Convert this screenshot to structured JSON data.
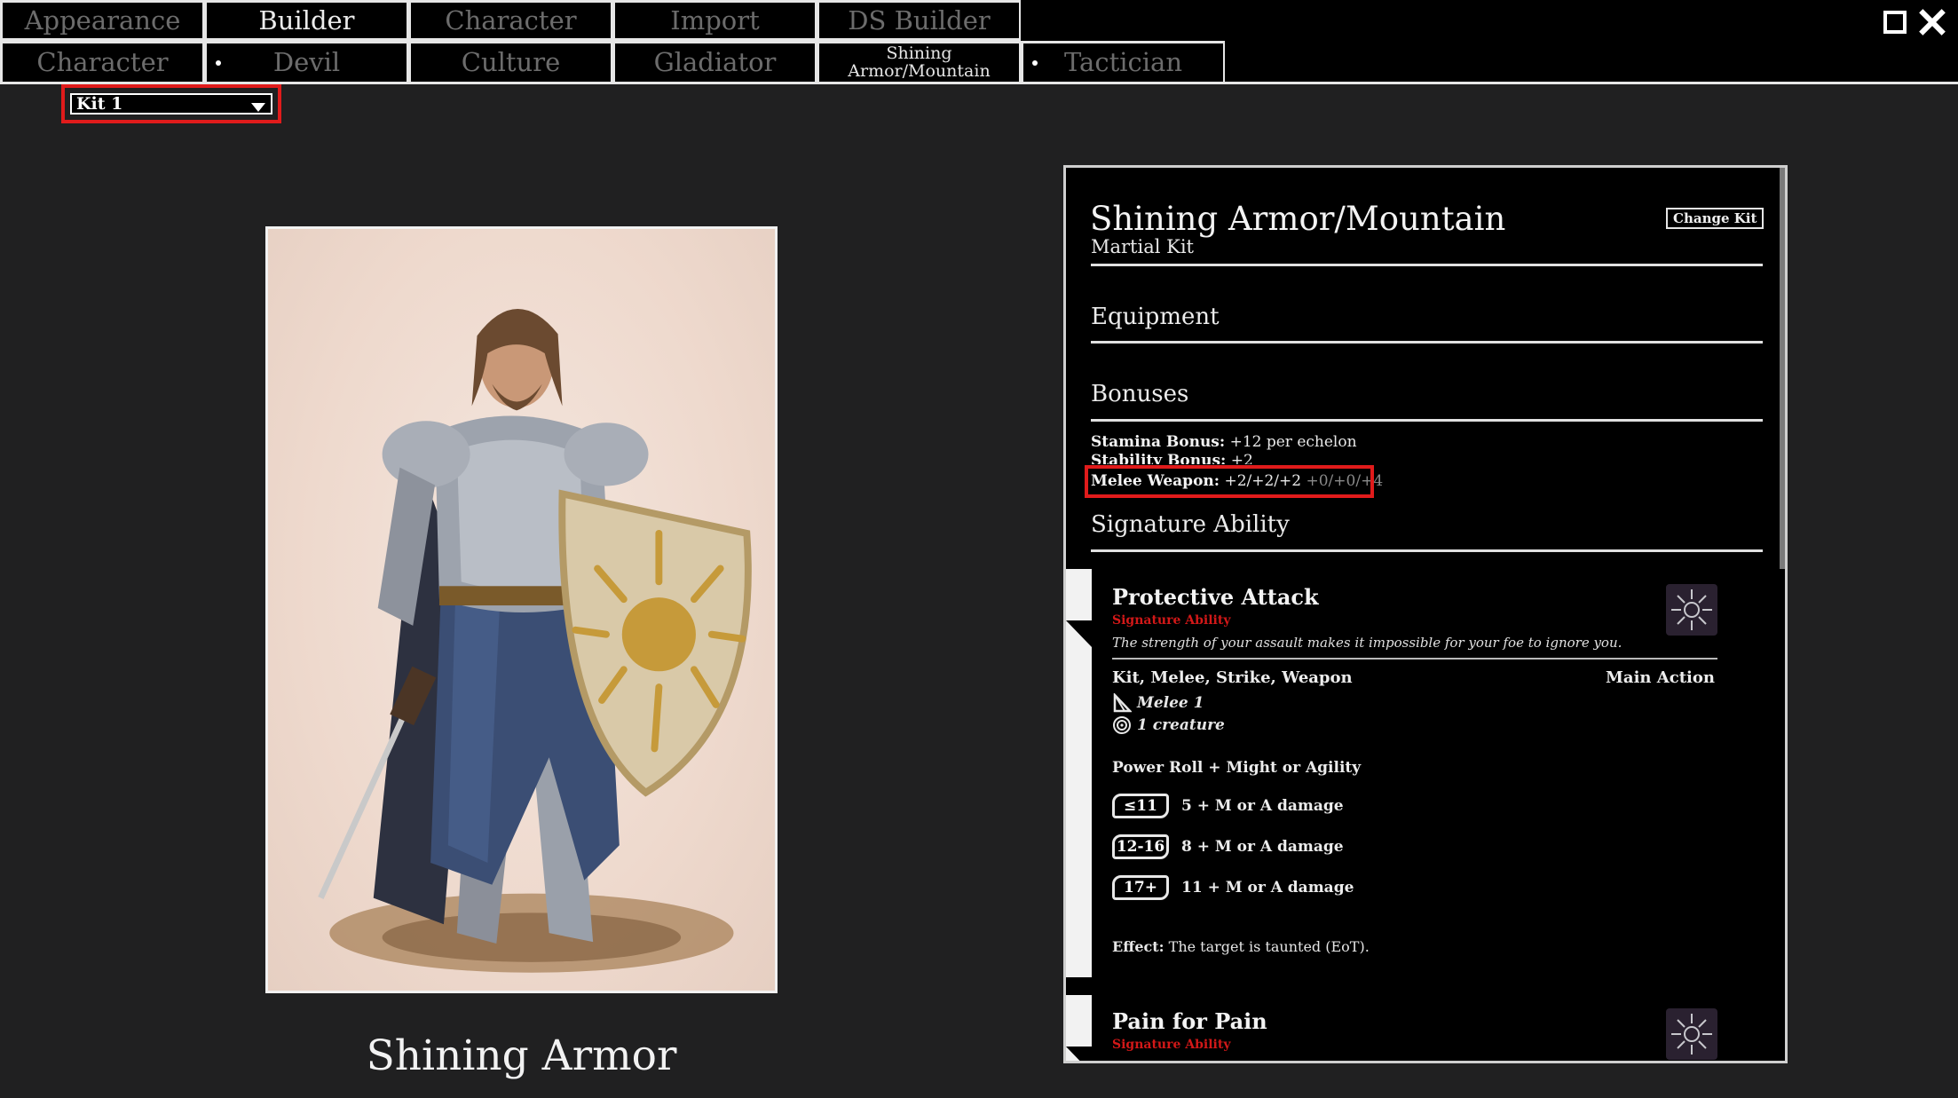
{
  "window": {
    "row1_tabs": [
      "Appearance",
      "Builder",
      "Character",
      "Import",
      "DS Builder"
    ],
    "row2_tabs": [
      "Character",
      "Devil",
      "Culture",
      "Gladiator",
      "Shining Armor/Mountain",
      "Tactician"
    ],
    "active_row1": "Builder"
  },
  "kit_select": {
    "value": "Kit 1"
  },
  "portrait": {
    "caption": "Shining Armor"
  },
  "kit": {
    "title": "Shining Armor/Mountain",
    "subtitle": "Martial Kit",
    "change_label": "Change Kit",
    "sections": {
      "equipment": "Equipment",
      "bonuses": "Bonuses",
      "signature": "Signature Ability"
    },
    "bonuses": {
      "stamina_label": "Stamina Bonus:",
      "stamina_value": "+12 per echelon",
      "stability_label": "Stability Bonus:",
      "stability_value": "+2",
      "melee_label": "Melee Weapon:",
      "melee_value": "+2/+2/+2",
      "melee_dim": "+0/+0/+4"
    }
  },
  "abilities": [
    {
      "name": "Protective Attack",
      "type": "Signature Ability",
      "flavor": "The strength of your assault makes it impossible for your foe to ignore you.",
      "keywords": "Kit, Melee, Strike, Weapon",
      "action": "Main Action",
      "distance": "Melee 1",
      "target": "1 creature",
      "power_roll": "Power Roll + Might or Agility",
      "tiers": [
        {
          "badge": "≤11",
          "text": "5 + M or A damage"
        },
        {
          "badge": "12-16",
          "text": "8 + M or A damage"
        },
        {
          "badge": "17+",
          "text": "11 + M or A damage"
        }
      ],
      "effect_label": "Effect:",
      "effect_text": "The target is taunted (EoT)."
    },
    {
      "name": "Pain for Pain",
      "type": "Signature Ability"
    }
  ],
  "colors": {
    "accent_red": "#e01b1b",
    "signature_red": "#d21818",
    "background": "#202021"
  }
}
